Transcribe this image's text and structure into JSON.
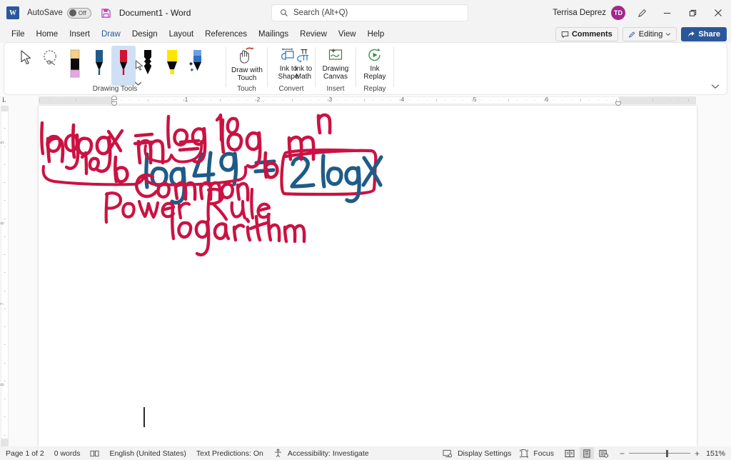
{
  "titlebar": {
    "app_logo": "word-logo",
    "autosave_label": "AutoSave",
    "autosave_state": "Off",
    "save_icon": "save-icon",
    "document_title": "Document1",
    "separator": "-",
    "app_name": "Word",
    "search_placeholder": "Search (Alt+Q)",
    "user_name": "Terrisa Deprez",
    "user_initials": "TD",
    "ribbon_display_options": "ribbon-display-options-icon",
    "minimize": "minimize-icon",
    "restore": "restore-icon",
    "close": "close-icon"
  },
  "tabs": [
    {
      "label": "File",
      "active": false
    },
    {
      "label": "Home",
      "active": false
    },
    {
      "label": "Insert",
      "active": false
    },
    {
      "label": "Draw",
      "active": true
    },
    {
      "label": "Design",
      "active": false
    },
    {
      "label": "Layout",
      "active": false
    },
    {
      "label": "References",
      "active": false
    },
    {
      "label": "Mailings",
      "active": false
    },
    {
      "label": "Review",
      "active": false
    },
    {
      "label": "View",
      "active": false
    },
    {
      "label": "Help",
      "active": false
    }
  ],
  "tabbar_right": {
    "comments_label": "Comments",
    "editing_label": "Editing",
    "share_label": "Share"
  },
  "ribbon": {
    "groups": [
      {
        "name": "Drawing Tools",
        "label": "Drawing Tools"
      },
      {
        "name": "Touch",
        "label": "Touch"
      },
      {
        "name": "Convert",
        "label": "Convert"
      },
      {
        "name": "Insert",
        "label": "Insert"
      },
      {
        "name": "Replay",
        "label": "Replay"
      }
    ],
    "drawing_tools": [
      {
        "name": "select-tool",
        "icon": "cursor-arrow-icon",
        "selected": false
      },
      {
        "name": "lasso-select-tool",
        "icon": "lasso-select-icon",
        "selected": false
      },
      {
        "name": "eraser-tool",
        "icon": "eraser-icon",
        "selected": false
      },
      {
        "name": "pen-blue-tool",
        "icon": "pen-icon",
        "selected": false,
        "color": "#1f5b87"
      },
      {
        "name": "pen-red-tool",
        "icon": "pen-icon",
        "selected": true,
        "color": "#d01030"
      },
      {
        "name": "pencil-black-tool",
        "icon": "pencil-icon",
        "selected": false,
        "color": "#000000"
      },
      {
        "name": "highlighter-yellow-tool",
        "icon": "highlighter-icon",
        "selected": false,
        "color": "#ffe600"
      },
      {
        "name": "action-pen-tool",
        "icon": "action-pen-icon",
        "selected": false,
        "color": "#2f6fc4"
      }
    ],
    "buttons": [
      {
        "name": "draw-with-touch",
        "line1": "Draw with",
        "line2": "Touch",
        "icon": "hand-draw-icon"
      },
      {
        "name": "ink-to-shape",
        "line1": "Ink to",
        "line2": "Shape",
        "icon": "ink-to-shape-icon"
      },
      {
        "name": "ink-to-math",
        "line1": "Ink to",
        "line2": "Math",
        "icon": "ink-to-math-icon"
      },
      {
        "name": "drawing-canvas",
        "line1": "Drawing",
        "line2": "Canvas",
        "icon": "drawing-canvas-icon"
      },
      {
        "name": "ink-replay",
        "line1": "Ink",
        "line2": "Replay",
        "icon": "ink-replay-icon"
      }
    ],
    "collapse_icon": "chevron-down-icon"
  },
  "ruler": {
    "corner_label": "L",
    "horizontal_numbers": [
      "1",
      "2",
      "3",
      "4",
      "5",
      "6"
    ],
    "vertical_numbers": [
      "5",
      "6",
      "7",
      "8"
    ]
  },
  "document": {
    "ink_color_blue": "#1f5b87",
    "ink_color_red": "#cc1242",
    "annotations": [
      {
        "name": "ink-equation-1",
        "text": "log 49 =",
        "color": "#1f5b87"
      },
      {
        "name": "ink-boxed-expression",
        "text": "2 log X",
        "color": "#1f5b87"
      },
      {
        "name": "ink-highlight-box",
        "text": "",
        "color": "#cc1242"
      },
      {
        "name": "ink-power-rule-eq",
        "text": "n log_b m = log_b m^n",
        "color": "#cc1242"
      },
      {
        "name": "ink-power-rule-label",
        "text": "Power Rule",
        "color": "#cc1242"
      },
      {
        "name": "ink-common-log-eq",
        "text": "log_10 X = log 10",
        "color": "#cc1242"
      },
      {
        "name": "ink-common-log-label",
        "text": "Common logarithm",
        "color": "#cc1242"
      }
    ]
  },
  "statusbar": {
    "page_info": "Page 1 of 2",
    "word_count": "0 words",
    "proofing_icon": "proofing-icon",
    "language": "English (United States)",
    "text_predictions": "Text Predictions: On",
    "accessibility": "Accessibility: Investigate",
    "display_settings": "Display Settings",
    "focus": "Focus",
    "view_read": "read-mode-icon",
    "view_print": "print-layout-icon",
    "view_web": "web-layout-icon",
    "zoom_out": "−",
    "zoom_in": "+",
    "zoom_level": "151%"
  }
}
